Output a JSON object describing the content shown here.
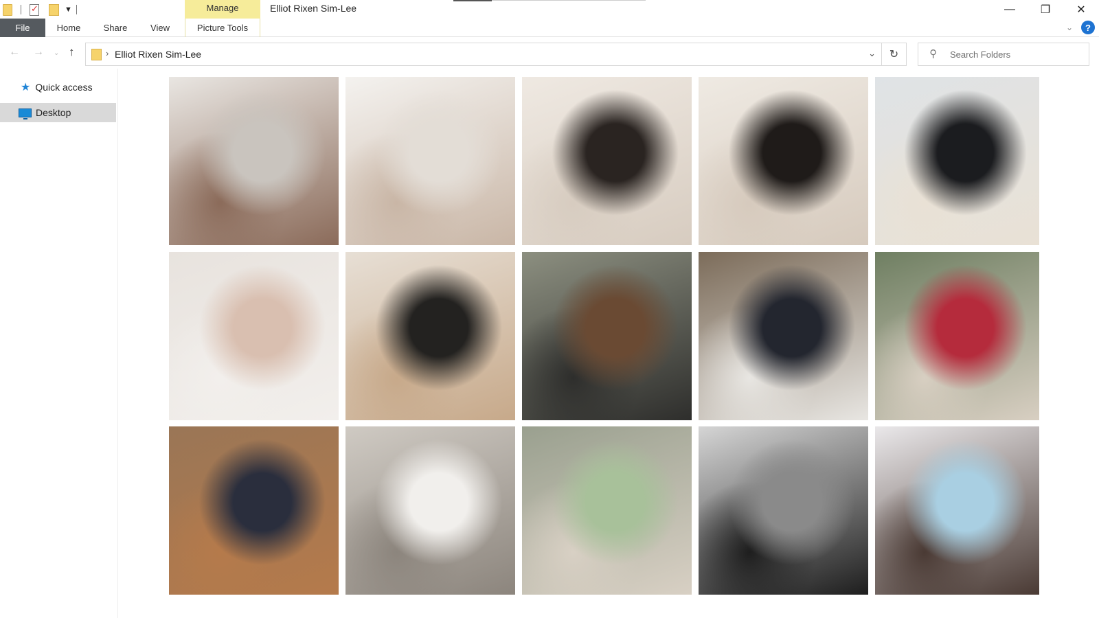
{
  "window": {
    "title": "Elliot Rixen Sim-Lee",
    "context_tab": "Manage",
    "minimize_glyph": "—",
    "restore_glyph": "❐",
    "close_glyph": "✕"
  },
  "ribbon": {
    "tabs": [
      "File",
      "Home",
      "Share",
      "View",
      "Picture Tools"
    ],
    "help_glyph": "?"
  },
  "address_bar": {
    "breadcrumb": "Elliot Rixen Sim-Lee",
    "search_placeholder": "Search Folders"
  },
  "nav_pane": {
    "items": [
      {
        "label": "Quick access",
        "icon": "pin-star-icon"
      },
      {
        "label": "Desktop",
        "icon": "desktop-icon",
        "selected": true
      }
    ]
  },
  "thumbnails": [
    {
      "subject": "newborn swaddled in hospital blanket, hand on face",
      "palette": [
        "#e9e6e2",
        "#c9c4be",
        "#8b6b5a"
      ]
    },
    {
      "subject": "newborn yawning on white bedding",
      "palette": [
        "#f4f2ef",
        "#e3ddd6",
        "#c9b6a6"
      ]
    },
    {
      "subject": "father leaning close to swaddled newborn on bed",
      "palette": [
        "#efe9e2",
        "#2a2421",
        "#d7ccc0"
      ]
    },
    {
      "subject": "father kissing newborn forehead",
      "palette": [
        "#efeae3",
        "#1f1b19",
        "#d6cabd"
      ]
    },
    {
      "subject": "newborn sleeping in knit blanket",
      "palette": [
        "#dfe3e6",
        "#1b1c1f",
        "#e9e1d5"
      ]
    },
    {
      "subject": "baby hand holding adult finger",
      "palette": [
        "#e8e3de",
        "#d9bfb0",
        "#f2efec"
      ]
    },
    {
      "subject": "father holding baby in living room",
      "palette": [
        "#e7dfd5",
        "#232220",
        "#c7a98a"
      ]
    },
    {
      "subject": "father feeding baby on wooden chairs",
      "palette": [
        "#8c8f80",
        "#6a4a33",
        "#2e2e2c"
      ]
    },
    {
      "subject": "father holding baby in cafe",
      "palette": [
        "#7c6c5a",
        "#23262f",
        "#e8e6e2"
      ]
    },
    {
      "subject": "father carrying baby outdoors by flowers",
      "palette": [
        "#6f7f62",
        "#b52b3c",
        "#d8cfc2"
      ]
    },
    {
      "subject": "father holding baby in wooden room",
      "palette": [
        "#9a7656",
        "#2a2e3d",
        "#b57a4b"
      ]
    },
    {
      "subject": "parent reaching to baby in bassinet",
      "palette": [
        "#cfcac3",
        "#f1efec",
        "#8c857d"
      ]
    },
    {
      "subject": "father with green stroller on street",
      "palette": [
        "#9aa08f",
        "#a8c19a",
        "#d8d0c4"
      ]
    },
    {
      "subject": "black and white close-up of eye",
      "palette": [
        "#d5d5d5",
        "#8a8a8a",
        "#1e1e1e"
      ]
    },
    {
      "subject": "baby in blue hooded robe",
      "palette": [
        "#eae8ea",
        "#a9cfe2",
        "#4a3a34"
      ]
    }
  ]
}
